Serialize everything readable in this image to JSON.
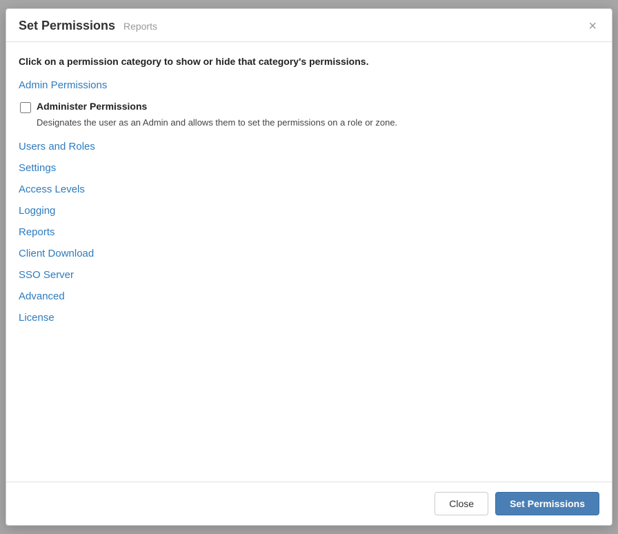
{
  "modal": {
    "title": "Set Permissions",
    "subtitle": "Reports",
    "close_button_label": "×",
    "instruction": "Click on a permission category to show or hide that category's permissions.",
    "categories": [
      {
        "id": "admin-permissions",
        "label": "Admin Permissions"
      },
      {
        "id": "users-and-roles",
        "label": "Users and Roles"
      },
      {
        "id": "settings",
        "label": "Settings"
      },
      {
        "id": "access-levels",
        "label": "Access Levels"
      },
      {
        "id": "logging",
        "label": "Logging"
      },
      {
        "id": "reports",
        "label": "Reports"
      },
      {
        "id": "client-download",
        "label": "Client Download"
      },
      {
        "id": "sso-server",
        "label": "SSO Server"
      },
      {
        "id": "advanced",
        "label": "Advanced"
      },
      {
        "id": "license",
        "label": "License"
      }
    ],
    "permissions": [
      {
        "id": "administer-permissions",
        "label": "Administer Permissions",
        "description": "Designates the user as an Admin and allows them to set the permissions on a role or zone.",
        "checked": false
      }
    ],
    "footer": {
      "close_label": "Close",
      "set_permissions_label": "Set Permissions"
    }
  }
}
